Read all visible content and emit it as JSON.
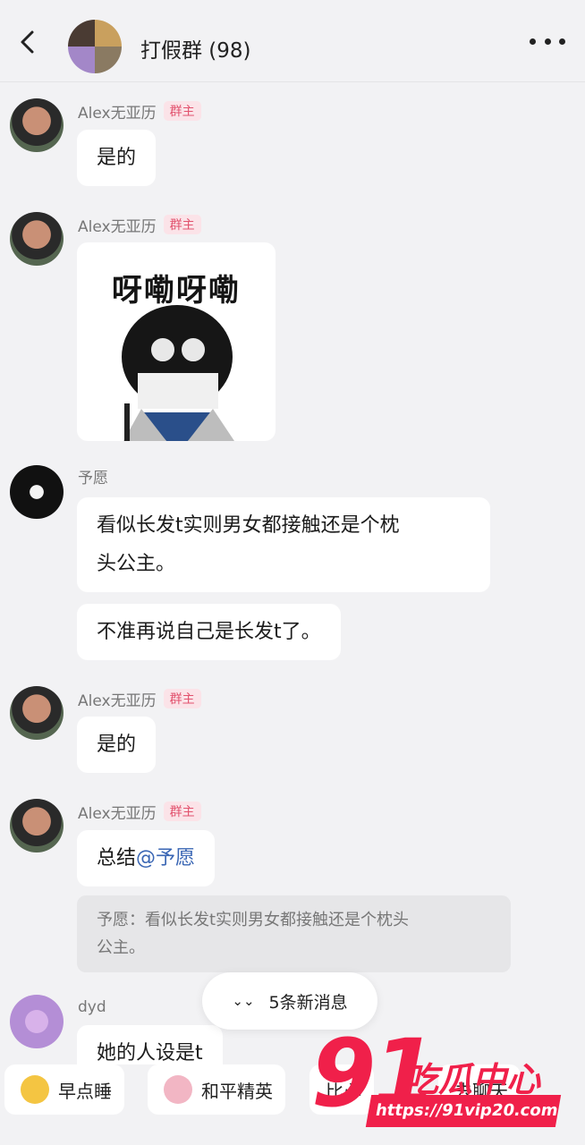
{
  "header": {
    "title": "打假群 (98)"
  },
  "messages": [
    {
      "sender": "Alex无亚历",
      "badge": "群主",
      "text": "是的"
    },
    {
      "sender": "Alex无亚历",
      "badge": "群主",
      "sticker_text": "呀嘞呀嘞"
    },
    {
      "sender": "予愿",
      "lines": [
        "看似长发t实则男女都接触还是个枕",
        "头公主。"
      ],
      "text2": "不准再说自己是长发t了。"
    },
    {
      "sender": "Alex无亚历",
      "badge": "群主",
      "text": "是的"
    },
    {
      "sender": "Alex无亚历",
      "badge": "群主",
      "text_prefix": "总结",
      "mention": "@予愿",
      "quote_lines": [
        "予愿：看似长发t实则男女都接触还是个枕头",
        "公主。"
      ]
    },
    {
      "sender": "dyd",
      "text": "她的人设是t"
    }
  ],
  "new_messages_pill": "5条新消息",
  "quick_chips": [
    "早点睡",
    "和平精英",
    "比心",
    "去聊天"
  ],
  "watermark": {
    "big": "91",
    "cn": "吃瓜中心",
    "url": "https://91vip20.com"
  },
  "colors": {
    "background": "#f2f2f4",
    "bubble": "#ffffff",
    "badge_text": "#e2526e",
    "badge_bg": "#fbe3e8",
    "mention": "#3a66b4",
    "watermark": "#f0204a"
  }
}
